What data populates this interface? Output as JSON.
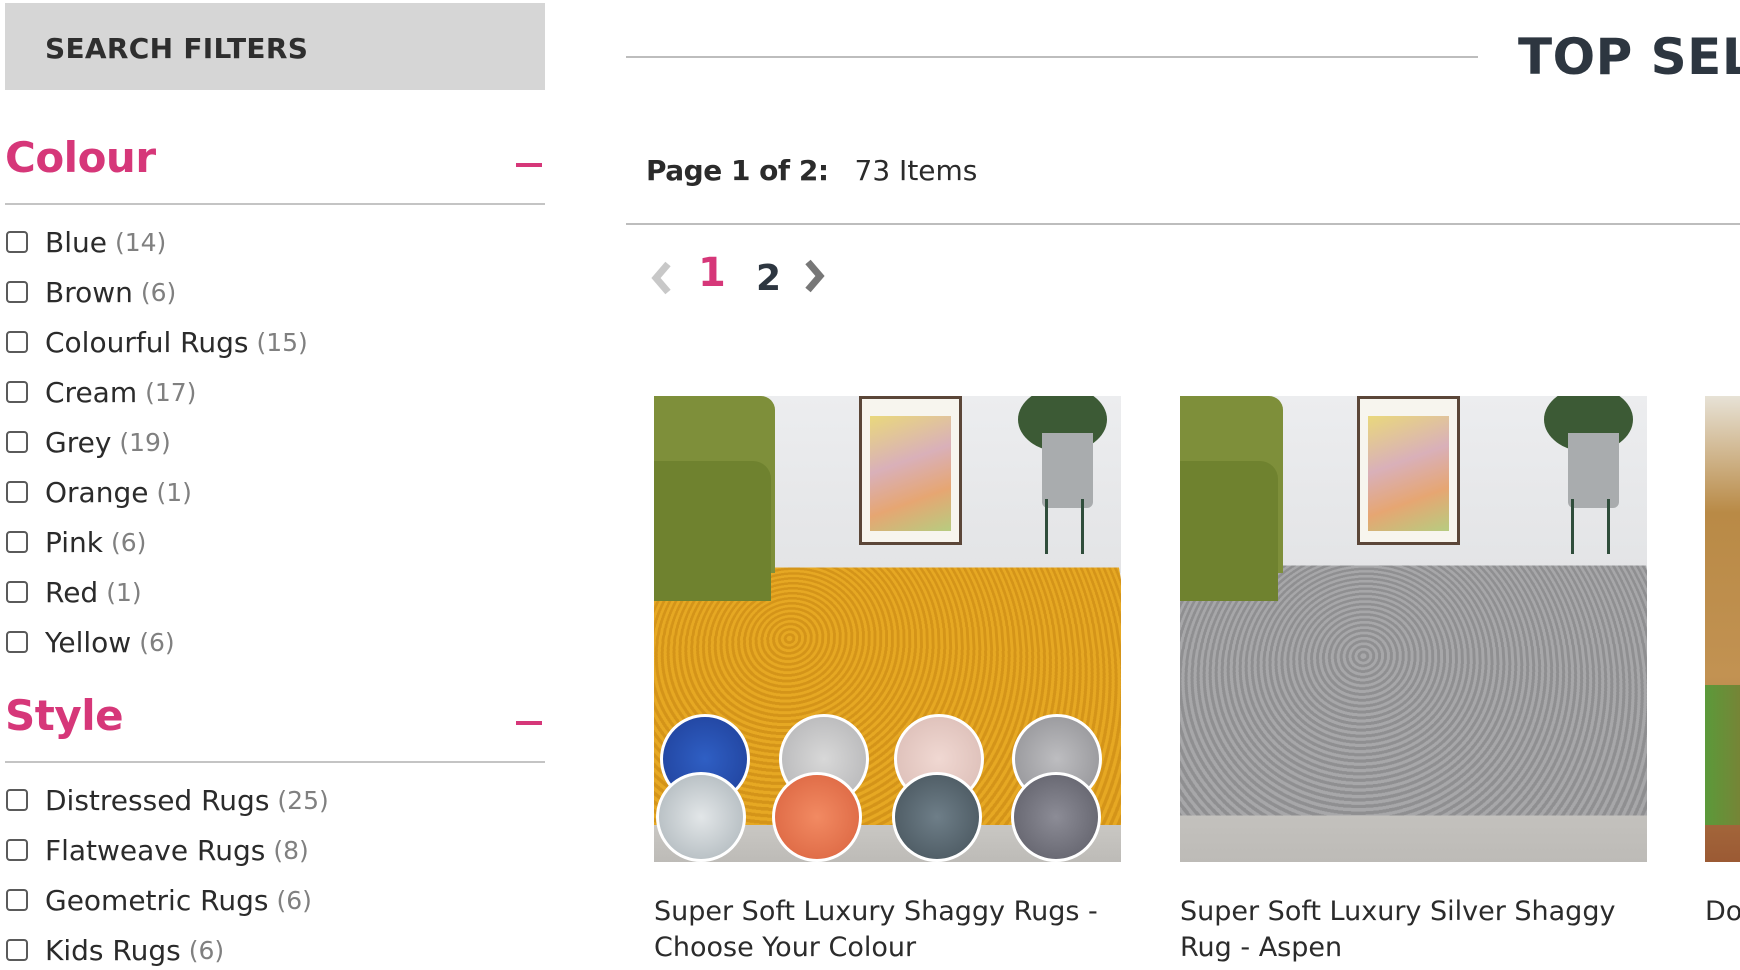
{
  "sidebar": {
    "header": "SEARCH FILTERS",
    "facets": [
      {
        "title": "Colour",
        "toggle_icon": "minus-icon",
        "items": [
          {
            "label": "Blue",
            "count": "(14)"
          },
          {
            "label": "Brown",
            "count": "(6)"
          },
          {
            "label": "Colourful Rugs",
            "count": "(15)"
          },
          {
            "label": "Cream",
            "count": "(17)"
          },
          {
            "label": "Grey",
            "count": "(19)"
          },
          {
            "label": "Orange",
            "count": "(1)"
          },
          {
            "label": "Pink",
            "count": "(6)"
          },
          {
            "label": "Red",
            "count": "(1)"
          },
          {
            "label": "Yellow",
            "count": "(6)"
          }
        ]
      },
      {
        "title": "Style",
        "toggle_icon": "minus-icon",
        "items": [
          {
            "label": "Distressed Rugs",
            "count": "(25)"
          },
          {
            "label": "Flatweave Rugs",
            "count": "(8)"
          },
          {
            "label": "Geometric Rugs",
            "count": "(6)"
          },
          {
            "label": "Kids Rugs",
            "count": "(6)"
          }
        ]
      }
    ]
  },
  "main": {
    "section_title": "TOP SELL",
    "page_info": {
      "label": "Page 1 of 2:",
      "items": "73 Items"
    },
    "pagination": {
      "prev_icon": "chevron-left-icon",
      "pages": [
        "1",
        "2"
      ],
      "current": "1",
      "next_icon": "chevron-right-icon"
    },
    "products": [
      {
        "title": "Super Soft Luxury Shaggy Rugs - Choose Your Colour",
        "image": "yellow-shaggy-rug-with-colour-swatches"
      },
      {
        "title": "Super Soft Luxury Silver Shaggy Rug - Aspen",
        "image": "silver-shaggy-rug"
      },
      {
        "title": "Do",
        "image": "kids-playmat-rug"
      }
    ]
  },
  "colors": {
    "accent": "#d63779",
    "header_bg": "#d6d6d6",
    "heading_dark": "#2d3640",
    "rule": "#bdbdbd"
  }
}
